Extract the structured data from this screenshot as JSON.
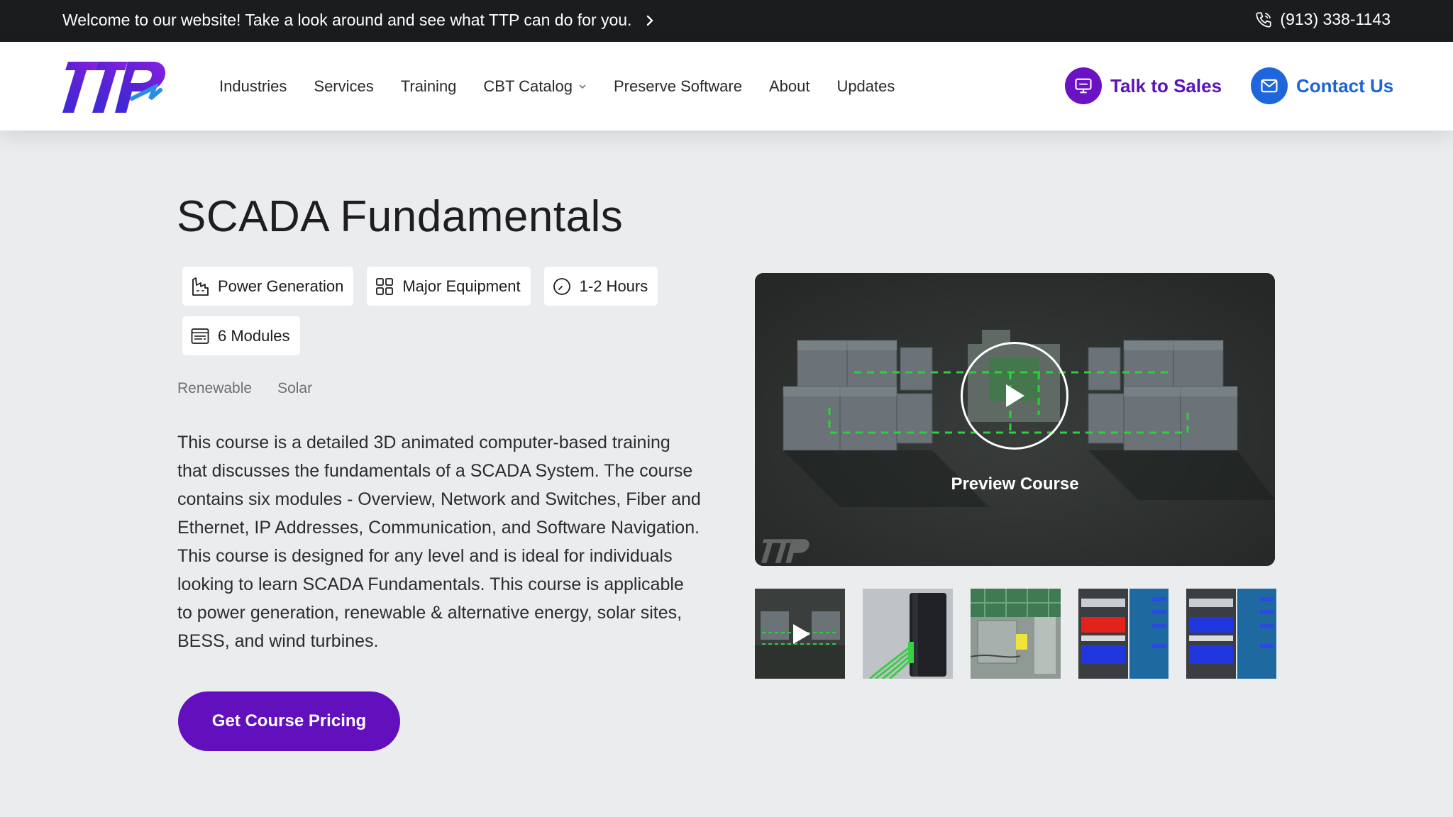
{
  "announcement": {
    "text": "Welcome to our website! Take a look around and see what TTP can do for you.",
    "phone": "(913) 338-1143"
  },
  "brand": {
    "logo_icon": "ttp-logo",
    "accent": "#6210bd",
    "blue": "#1f66dd"
  },
  "nav": {
    "items": [
      "Industries",
      "Services",
      "Training",
      "CBT Catalog",
      "Preserve Software",
      "About",
      "Updates"
    ],
    "talk_to_sales": "Talk to Sales",
    "contact_us": "Contact Us"
  },
  "course": {
    "title": "SCADA Fundamentals",
    "badges": [
      {
        "icon": "factory-icon",
        "label": "Power Generation"
      },
      {
        "icon": "grid-icon",
        "label": "Major Equipment"
      },
      {
        "icon": "clock-icon",
        "label": "1-2 Hours"
      },
      {
        "icon": "modules-icon",
        "label": "6 Modules"
      }
    ],
    "tags": [
      "Renewable",
      "Solar"
    ],
    "description": "This course is a detailed 3D animated computer-based training that discusses the fundamentals of a SCADA System. The course contains six modules - Overview, Network and Switches, Fiber and Ethernet, IP Addresses, Communication, and Software Navigation. This course is designed for any level and is ideal for individuals looking to learn SCADA Fundamentals. This course is applicable to power generation, renewable & alternative energy, solar sites, BESS, and wind turbines.",
    "pricing_button": "Get Course Pricing"
  },
  "video": {
    "label": "Preview Course",
    "play_icon": "play-icon"
  },
  "thumbnails": [
    {
      "name": "thumb-video-preview",
      "icon": "play-icon"
    },
    {
      "name": "thumb-fiber-cable"
    },
    {
      "name": "thumb-network-switch"
    },
    {
      "name": "thumb-rack-red"
    },
    {
      "name": "thumb-rack-blue"
    }
  ]
}
